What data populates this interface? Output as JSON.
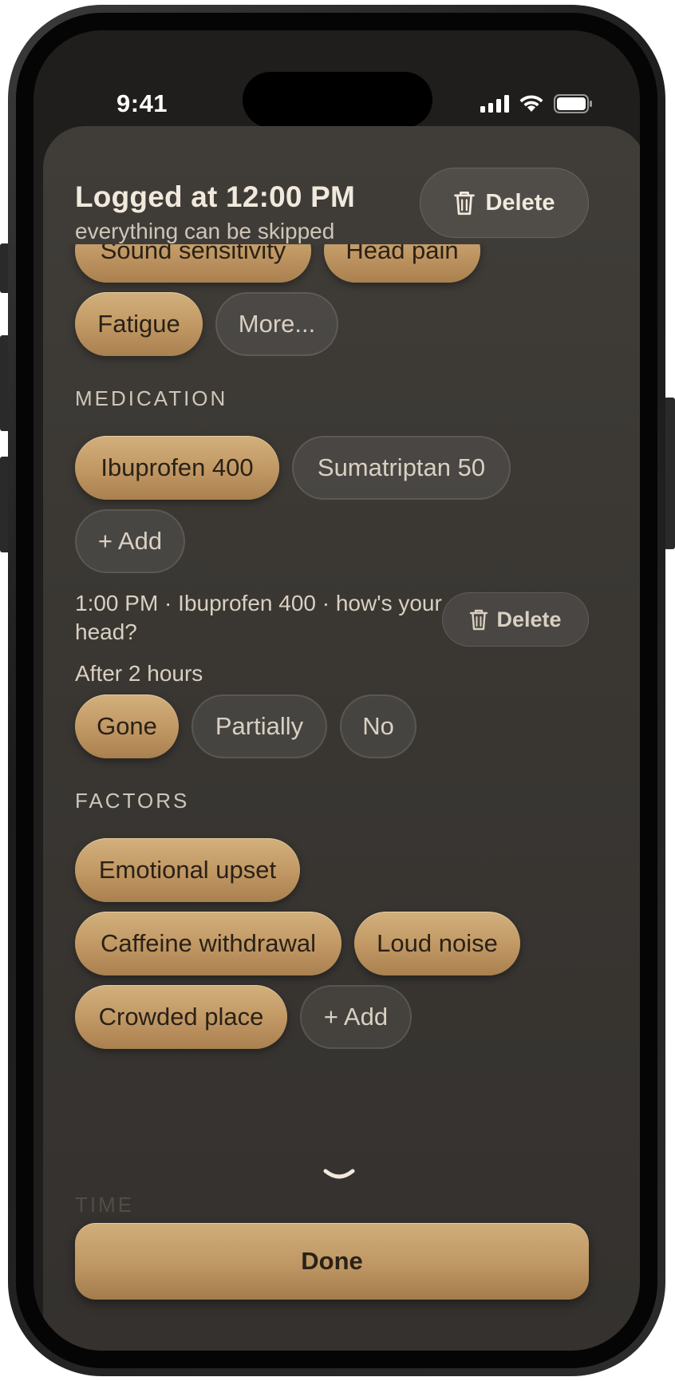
{
  "status_bar": {
    "time": "9:41"
  },
  "header": {
    "title": "Logged at 12:00 PM",
    "subtitle": "everything can be skipped",
    "delete_label": "Delete"
  },
  "symptoms": {
    "chips": [
      {
        "label": "Sound sensitivity",
        "selected": true
      },
      {
        "label": "Head pain",
        "selected": true
      },
      {
        "label": "Fatigue",
        "selected": true
      },
      {
        "label": "More...",
        "selected": false
      }
    ]
  },
  "medication": {
    "section_label": "MEDICATION",
    "chips": [
      {
        "label": "Ibuprofen 400",
        "selected": true
      },
      {
        "label": "Sumatriptan 50",
        "selected": false
      },
      {
        "label": "+ Add",
        "selected": false
      }
    ],
    "followup": {
      "note": "1:00 PM · Ibuprofen 400 · how's your head?",
      "delete_label": "Delete",
      "after_label": "After 2 hours",
      "options": [
        {
          "label": "Gone",
          "selected": true
        },
        {
          "label": "Partially",
          "selected": false
        },
        {
          "label": "No",
          "selected": false
        }
      ]
    }
  },
  "factors": {
    "section_label": "FACTORS",
    "chips": [
      {
        "label": "Emotional upset",
        "selected": true
      },
      {
        "label": "Caffeine withdrawal",
        "selected": true
      },
      {
        "label": "Loud noise",
        "selected": true
      },
      {
        "label": "Crowded place",
        "selected": true
      },
      {
        "label": "+ Add",
        "selected": false
      }
    ]
  },
  "time_section": {
    "section_label": "TIME"
  },
  "footer": {
    "done_label": "Done"
  },
  "colors": {
    "accent_gold": "#c09763",
    "sheet_bg": "#3a3733",
    "text_primary": "#f1e9dc"
  }
}
